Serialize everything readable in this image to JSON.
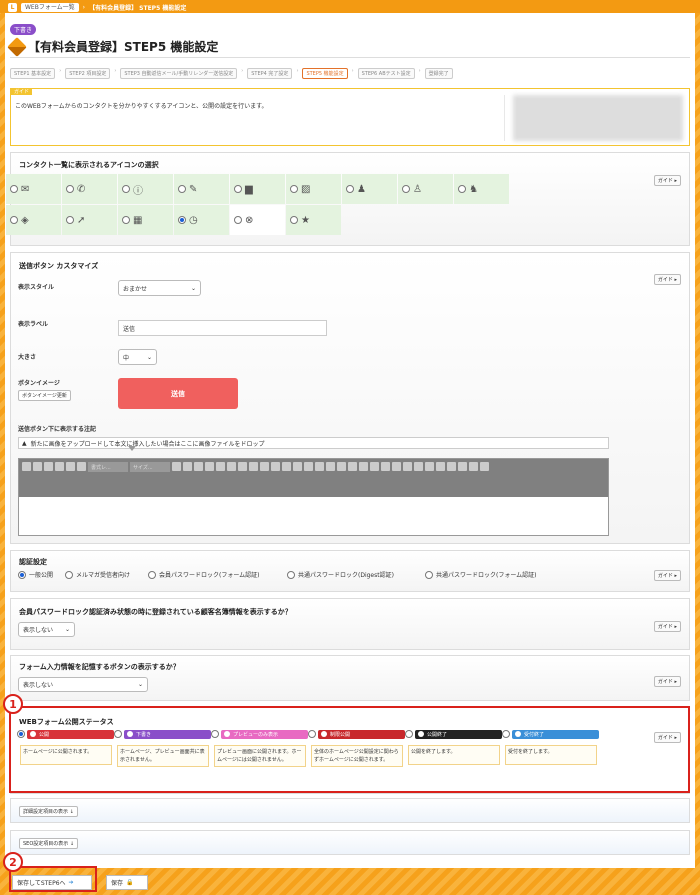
{
  "breadcrumb": {
    "logo": "L",
    "items": [
      "WEBフォーム一覧",
      "【有料会員登録】 STEP5 機能設定"
    ]
  },
  "status_badge": "下書き",
  "page_title": "【有料会員登録】STEP5 機能設定",
  "steps": [
    "STEP1 基本設定",
    "STEP2 項目設定",
    "STEP3 自動返信メール/手動リレンダー送信設定",
    "STEP4 完了設定",
    "STEP5 機能設定",
    "STEP6 ABテスト設定",
    "登録完了"
  ],
  "guide": {
    "tag": "ガイド",
    "text": "このWEBフォームからのコンタクトを分かりやすくするアイコンと、公開の設定を行います。"
  },
  "guide_button": "ガイド ▸",
  "icon_section": {
    "title": "コンタクト一覧に表示されるアイコンの選択",
    "icons": [
      "mail-icon",
      "phone-icon",
      "alert-icon",
      "pencil-icon",
      "screen-icon",
      "note-icon",
      "person-icon",
      "person-alt-icon",
      "people-icon",
      "box-icon",
      "arrow-icon",
      "calendar-icon",
      "clock-icon",
      "cancel-icon",
      "star-icon"
    ],
    "selected": 12
  },
  "send_button_section": {
    "title": "送信ボタン カスタマイズ",
    "style_label": "表示スタイル",
    "style_value": "おまかせ",
    "label_label": "表示ラベル",
    "label_value": "送信",
    "size_label": "大きさ",
    "size_value": "中",
    "image_label": "ボタンイメージ",
    "image_button": "ボタンイメージ更新",
    "preview_text": "送信",
    "note_label": "送信ボタン下に表示する注記",
    "drop_text": "新たに画像をアップロードして本文に挿入したい場合はここに画像ファイルをドロップ",
    "toolbar_selects": [
      "書式レ...",
      "サイズ..."
    ]
  },
  "auth_section": {
    "title": "認証設定",
    "options": [
      "一般公開",
      "メルマガ受信者向け",
      "会員パスワードロック(フォーム認証)",
      "共通パスワードロック(Digest認証)",
      "共通パスワードロック(フォーム認証)"
    ],
    "selected": 0
  },
  "member_section": {
    "title": "会員パスワードロック認証済み状態の時に登録されている顧客名簿情報を表示するか？",
    "value": "表示しない"
  },
  "remember_section": {
    "title": "フォーム入力情報を記憶するボタンの表示するか？",
    "value": "表示しない"
  },
  "status_section": {
    "title": "WEBフォーム公開ステータス",
    "statuses": [
      {
        "name": "公開",
        "color": "#d8333a",
        "desc": "ホームページに公開されます。"
      },
      {
        "name": "下書き",
        "color": "#8a4ec9",
        "desc": "ホームページ、プレビュー画面共に表示されません。"
      },
      {
        "name": "プレビューのみ表示",
        "color": "#e86ac2",
        "desc": "プレビュー画面に公開されます。ホームページには公開されません。"
      },
      {
        "name": "制限公開",
        "color": "#c8282c",
        "desc": "全体のホームページ公開設定に関わらずホームページに公開されます。"
      },
      {
        "name": "公開終了",
        "color": "#222222",
        "desc": "公開を終了します。"
      },
      {
        "name": "受付終了",
        "color": "#3a8fd8",
        "desc": "受付を終了します。"
      }
    ],
    "selected": 0
  },
  "detail_toggle": "詳細設定項目の表示 ↓",
  "seo_toggle": "SEO設定項目の表示 ↓",
  "callouts": [
    "1",
    "2"
  ],
  "footer": {
    "next_button": "保存してSTEP6へ",
    "save_button": "保存"
  }
}
